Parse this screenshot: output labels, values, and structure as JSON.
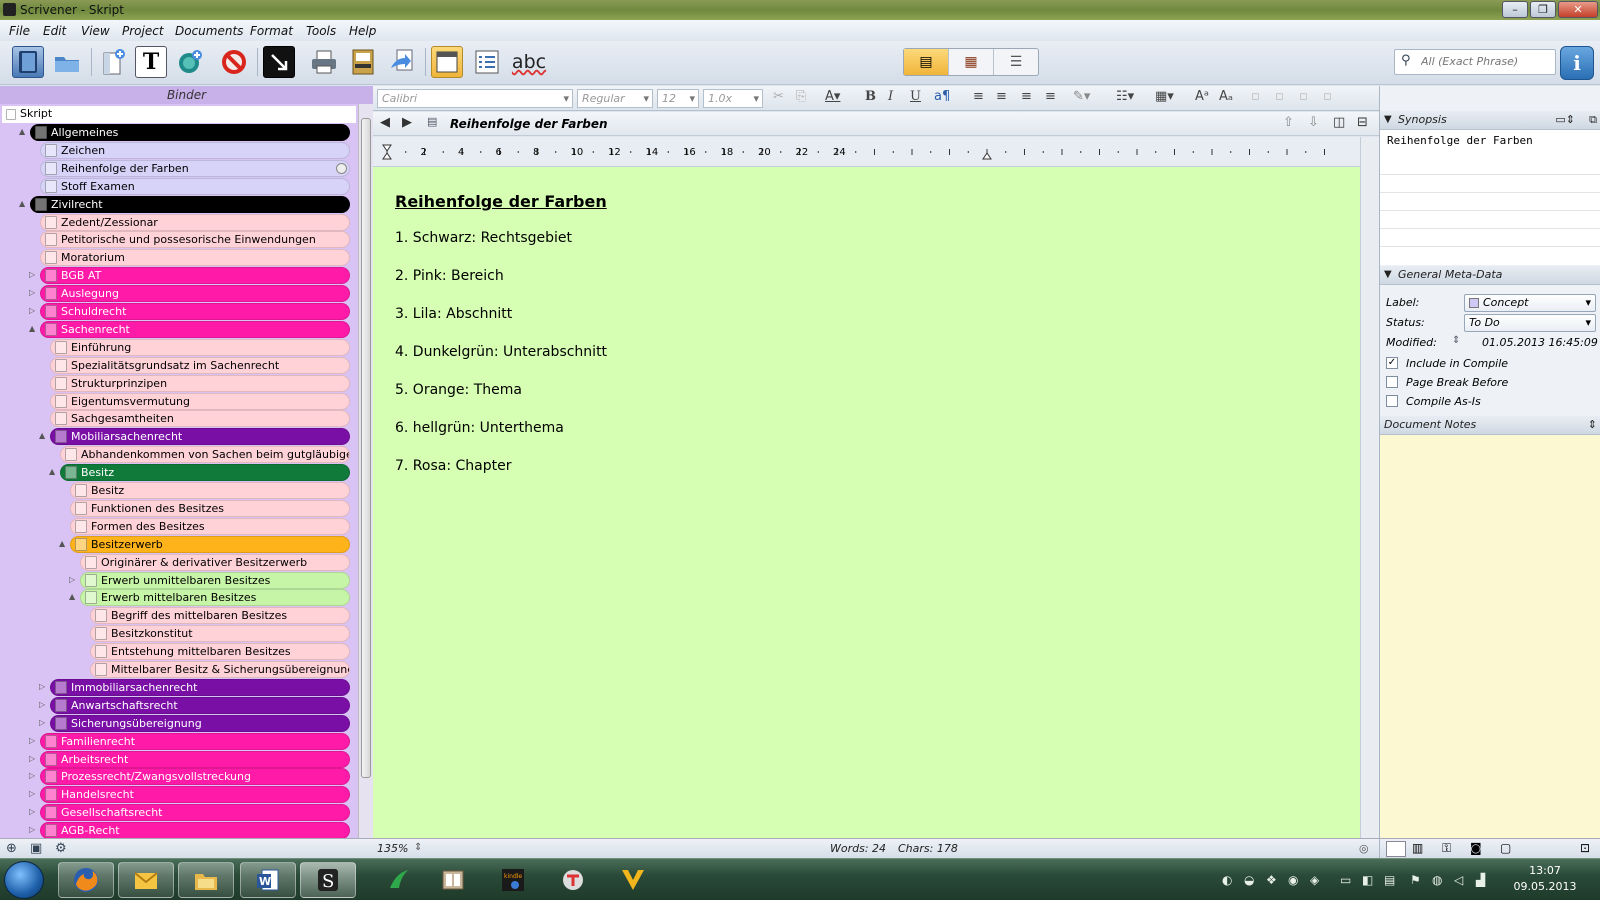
{
  "window": {
    "title": "Scrivener - Skript",
    "controls": [
      "–",
      "❐",
      "✕"
    ]
  },
  "menu": [
    "File",
    "Edit",
    "View",
    "Project",
    "Documents",
    "Format",
    "Tools",
    "Help"
  ],
  "toolbar": {
    "icons": [
      "binder-icon",
      "collections-icon",
      "add-doc-icon",
      "text-icon",
      "target-icon",
      "no-icon",
      "fullscreen-icon",
      "print-icon",
      "compile-icon",
      "export-icon",
      "layout-icon",
      "checklist-icon"
    ],
    "spell_label": "abc",
    "search_placeholder": "All (Exact Phrase)",
    "info_label": "i"
  },
  "binder": {
    "header": "Binder",
    "root": "Skript",
    "items": [
      {
        "label": "Allgemeines",
        "depth": 1,
        "color": "#000000",
        "text": "#ffffff",
        "twisty": "▲"
      },
      {
        "label": "Zeichen",
        "depth": 2,
        "color": "#d6d2f8",
        "text": "#000000",
        "twisty": ""
      },
      {
        "label": "Reihenfolge der Farben",
        "depth": 2,
        "color": "#d6d2f8",
        "text": "#000000",
        "twisty": ""
      },
      {
        "label": "Stoff Examen",
        "depth": 2,
        "color": "#d6d2f8",
        "text": "#000000",
        "twisty": ""
      },
      {
        "label": "Zivilrecht",
        "depth": 1,
        "color": "#000000",
        "text": "#ffffff",
        "twisty": "▲"
      },
      {
        "label": "Zedent/Zessionar",
        "depth": 2,
        "color": "#ffd2d8",
        "text": "#000000",
        "twisty": ""
      },
      {
        "label": "Petitorische und possesorische Einwendungen",
        "depth": 2,
        "color": "#ffd2d8",
        "text": "#000000",
        "twisty": ""
      },
      {
        "label": "Moratorium",
        "depth": 2,
        "color": "#ffd2d8",
        "text": "#000000",
        "twisty": ""
      },
      {
        "label": "BGB AT",
        "depth": 2,
        "color": "#ff1aa8",
        "text": "#ffffff",
        "twisty": "▷"
      },
      {
        "label": "Auslegung",
        "depth": 2,
        "color": "#ff1aa8",
        "text": "#ffffff",
        "twisty": "▷"
      },
      {
        "label": "Schuldrecht",
        "depth": 2,
        "color": "#ff1aa8",
        "text": "#ffffff",
        "twisty": "▷"
      },
      {
        "label": "Sachenrecht",
        "depth": 2,
        "color": "#ff1aa8",
        "text": "#ffffff",
        "twisty": "▲"
      },
      {
        "label": "Einführung",
        "depth": 3,
        "color": "#ffd2d8",
        "text": "#000000",
        "twisty": ""
      },
      {
        "label": "Spezialitätsgrundsatz im Sachenrecht",
        "depth": 3,
        "color": "#ffd2d8",
        "text": "#000000",
        "twisty": ""
      },
      {
        "label": "Strukturprinzipen",
        "depth": 3,
        "color": "#ffd2d8",
        "text": "#000000",
        "twisty": ""
      },
      {
        "label": "Eigentumsvermutung",
        "depth": 3,
        "color": "#ffd2d8",
        "text": "#000000",
        "twisty": ""
      },
      {
        "label": "Sachgesamtheiten",
        "depth": 3,
        "color": "#ffd2d8",
        "text": "#000000",
        "twisty": ""
      },
      {
        "label": "Mobiliarsachenrecht",
        "depth": 3,
        "color": "#7a0fa6",
        "text": "#ffffff",
        "twisty": "▲"
      },
      {
        "label": "Abhandenkommen von Sachen beim gutgläubigen...",
        "depth": 4,
        "color": "#ffd2d8",
        "text": "#000000",
        "twisty": ""
      },
      {
        "label": "Besitz",
        "depth": 4,
        "color": "#0f7a3a",
        "text": "#ffffff",
        "twisty": "▲"
      },
      {
        "label": "Besitz",
        "depth": 5,
        "color": "#ffd2d8",
        "text": "#000000",
        "twisty": ""
      },
      {
        "label": "Funktionen des Besitzes",
        "depth": 5,
        "color": "#ffd2d8",
        "text": "#000000",
        "twisty": ""
      },
      {
        "label": "Formen des Besitzes",
        "depth": 5,
        "color": "#ffd2d8",
        "text": "#000000",
        "twisty": ""
      },
      {
        "label": "Besitzerwerb",
        "depth": 5,
        "color": "#ffb31a",
        "text": "#000000",
        "twisty": "▲"
      },
      {
        "label": "Originärer & derivativer Besitzerwerb",
        "depth": 6,
        "color": "#ffd2d8",
        "text": "#000000",
        "twisty": ""
      },
      {
        "label": "Erwerb unmittelbaren Besitzes",
        "depth": 6,
        "color": "#c7f5a8",
        "text": "#000000",
        "twisty": "▷"
      },
      {
        "label": "Erwerb mittelbaren Besitzes",
        "depth": 6,
        "color": "#c7f5a8",
        "text": "#000000",
        "twisty": "▲"
      },
      {
        "label": "Begriff des mittelbaren Besitzes",
        "depth": 7,
        "color": "#ffd2d8",
        "text": "#000000",
        "twisty": ""
      },
      {
        "label": "Besitzkonstitut",
        "depth": 7,
        "color": "#ffd2d8",
        "text": "#000000",
        "twisty": ""
      },
      {
        "label": "Entstehung mittelbaren Besitzes",
        "depth": 7,
        "color": "#ffd2d8",
        "text": "#000000",
        "twisty": ""
      },
      {
        "label": "Mittelbarer Besitz & Sicherungsübereignung",
        "depth": 7,
        "color": "#ffd2d8",
        "text": "#000000",
        "twisty": ""
      },
      {
        "label": "Immobiliarsachenrecht",
        "depth": 3,
        "color": "#7a0fa6",
        "text": "#ffffff",
        "twisty": "▷"
      },
      {
        "label": "Anwartschaftsrecht",
        "depth": 3,
        "color": "#7a0fa6",
        "text": "#ffffff",
        "twisty": "▷"
      },
      {
        "label": "Sicherungsübereignung",
        "depth": 3,
        "color": "#7a0fa6",
        "text": "#ffffff",
        "twisty": "▷"
      },
      {
        "label": "Familienrecht",
        "depth": 2,
        "color": "#ff1aa8",
        "text": "#ffffff",
        "twisty": "▷"
      },
      {
        "label": "Arbeitsrecht",
        "depth": 2,
        "color": "#ff1aa8",
        "text": "#ffffff",
        "twisty": "▷"
      },
      {
        "label": "Prozessrecht/Zwangsvollstreckung",
        "depth": 2,
        "color": "#ff1aa8",
        "text": "#ffffff",
        "twisty": "▷"
      },
      {
        "label": "Handelsrecht",
        "depth": 2,
        "color": "#ff1aa8",
        "text": "#ffffff",
        "twisty": "▷"
      },
      {
        "label": "Gesellschaftsrecht",
        "depth": 2,
        "color": "#ff1aa8",
        "text": "#ffffff",
        "twisty": "▷"
      },
      {
        "label": "AGB-Recht",
        "depth": 2,
        "color": "#ff1aa8",
        "text": "#ffffff",
        "twisty": "▷"
      }
    ]
  },
  "format_bar": {
    "font": "Calibri",
    "style": "Regular",
    "size": "12",
    "spacing": "1.0x"
  },
  "editor": {
    "doc_title": "Reihenfolge der Farben",
    "heading": "Reihenfolge der Farben",
    "lines": [
      "1. Schwarz: Rechtsgebiet",
      "2. Pink: Bereich",
      "3. Lila: Abschnitt",
      "4. Dunkelgrün: Unterabschnitt",
      "5. Orange: Thema",
      "6. hellgrün: Unterthema",
      "7. Rosa: Chapter"
    ],
    "ruler_labels": [
      "2",
      "4",
      "6",
      "8",
      "10",
      "12",
      "14",
      "16",
      "18",
      "20",
      "22",
      "24"
    ],
    "page_color": "#d6ffb3"
  },
  "status": {
    "zoom": "135%",
    "words": "Words: 24",
    "chars": "Chars: 178"
  },
  "inspector": {
    "synopsis_title": "Synopsis",
    "synopsis_text": "Reihenfolge der Farben",
    "meta_title": "General Meta-Data",
    "label_caption": "Label:",
    "label_value": "Concept",
    "status_caption": "Status:",
    "status_value": "To Do",
    "modified_caption": "Modified:",
    "modified_value": "01.05.2013 16:45:09",
    "checks": [
      {
        "label": "Include in Compile",
        "checked": true
      },
      {
        "label": "Page Break Before",
        "checked": false
      },
      {
        "label": "Compile As-Is",
        "checked": false
      }
    ],
    "notes_title": "Document Notes"
  },
  "taskbar": {
    "time": "13:07",
    "date": "09.05.2013",
    "apps": [
      "firefox",
      "outlook",
      "explorer",
      "word",
      "scrivener",
      "app-green",
      "reader",
      "kindle",
      "app-vlc",
      "app-v"
    ]
  }
}
